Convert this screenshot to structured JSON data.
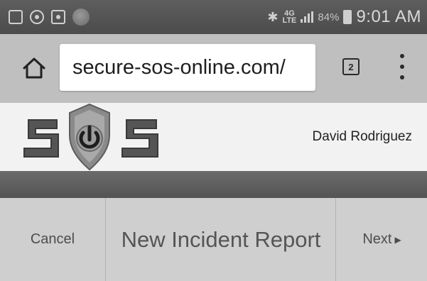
{
  "status_bar": {
    "clock": "9:01 AM",
    "battery_percent": "84%",
    "network": "4G LTE",
    "bluetooth_icon": "bluetooth-icon",
    "notification_icons": [
      "image-icon",
      "messenger-icon",
      "app-icon",
      "contact-avatar"
    ]
  },
  "browser": {
    "url": "secure-sos-online.com/",
    "tab_count": "2",
    "home_icon": "home-icon",
    "menu_icon": "overflow-menu-icon"
  },
  "site": {
    "logo_alt": "SOS",
    "user_name": "David Rodriguez"
  },
  "action_bar": {
    "cancel_label": "Cancel",
    "title": "New Incident Report",
    "next_label": "Next",
    "next_arrow": "▶"
  }
}
